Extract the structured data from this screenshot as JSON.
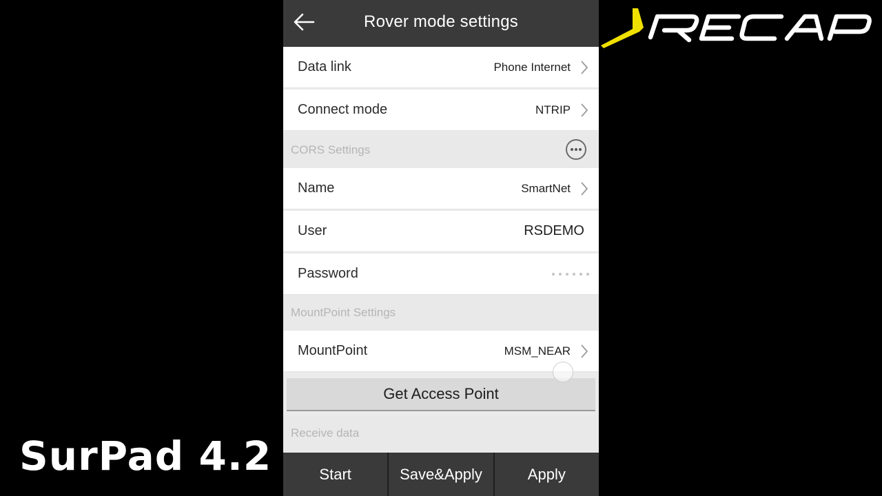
{
  "header": {
    "title": "Rover mode settings",
    "back_icon": "arrow-left-icon"
  },
  "rows": {
    "data_link": {
      "label": "Data link",
      "value": "Phone Internet"
    },
    "connect_mode": {
      "label": "Connect mode",
      "value": "NTRIP"
    },
    "name": {
      "label": "Name",
      "value": "SmartNet"
    },
    "user": {
      "label": "User",
      "value": "RSDEMO"
    },
    "password": {
      "label": "Password"
    },
    "mountpoint": {
      "label": "MountPoint",
      "value": "MSM_NEAR"
    }
  },
  "sections": {
    "cors": "CORS Settings",
    "mountpoint": "MountPoint Settings",
    "receive": "Receive data"
  },
  "buttons": {
    "get_access_point": "Get Access Point",
    "start": "Start",
    "save_apply": "Save&Apply",
    "apply": "Apply"
  },
  "overlay": {
    "brand": "SurPad 4.2",
    "logo_text": "RECAP"
  },
  "colors": {
    "bar": "#3a3a3a",
    "logo_accent": "#f0e000",
    "logo_text": "#ffffff"
  }
}
